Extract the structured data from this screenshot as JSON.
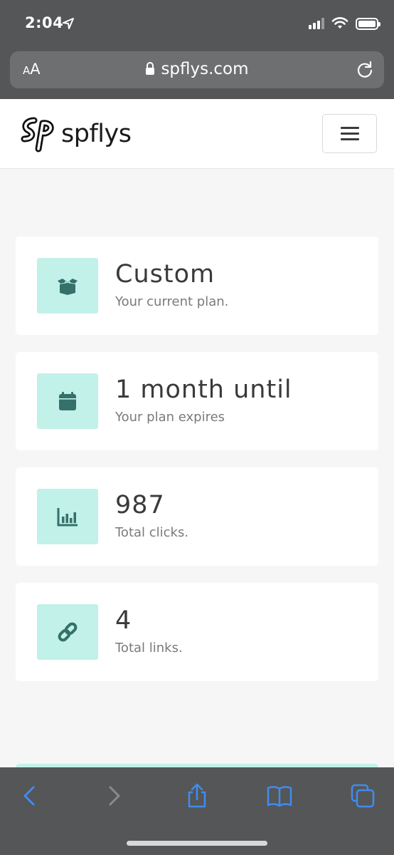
{
  "status_bar": {
    "time": "2:04"
  },
  "browser": {
    "text_size_small": "A",
    "text_size_big": "A",
    "url": "spflys.com"
  },
  "site": {
    "brand_name": "spflys"
  },
  "cards": [
    {
      "icon": "box-open-icon",
      "title": "Custom",
      "subtitle": "Your current plan."
    },
    {
      "icon": "calendar-icon",
      "title": "1 month until",
      "subtitle": "Your plan expires"
    },
    {
      "icon": "bar-chart-icon",
      "title": "987",
      "subtitle": "Total clicks."
    },
    {
      "icon": "link-icon",
      "title": "4",
      "subtitle": "Total links."
    }
  ],
  "colors": {
    "accent_bg": "#c1f1e9",
    "icon_color": "#35706a",
    "toolbar_blue": "#3f8cf0"
  }
}
